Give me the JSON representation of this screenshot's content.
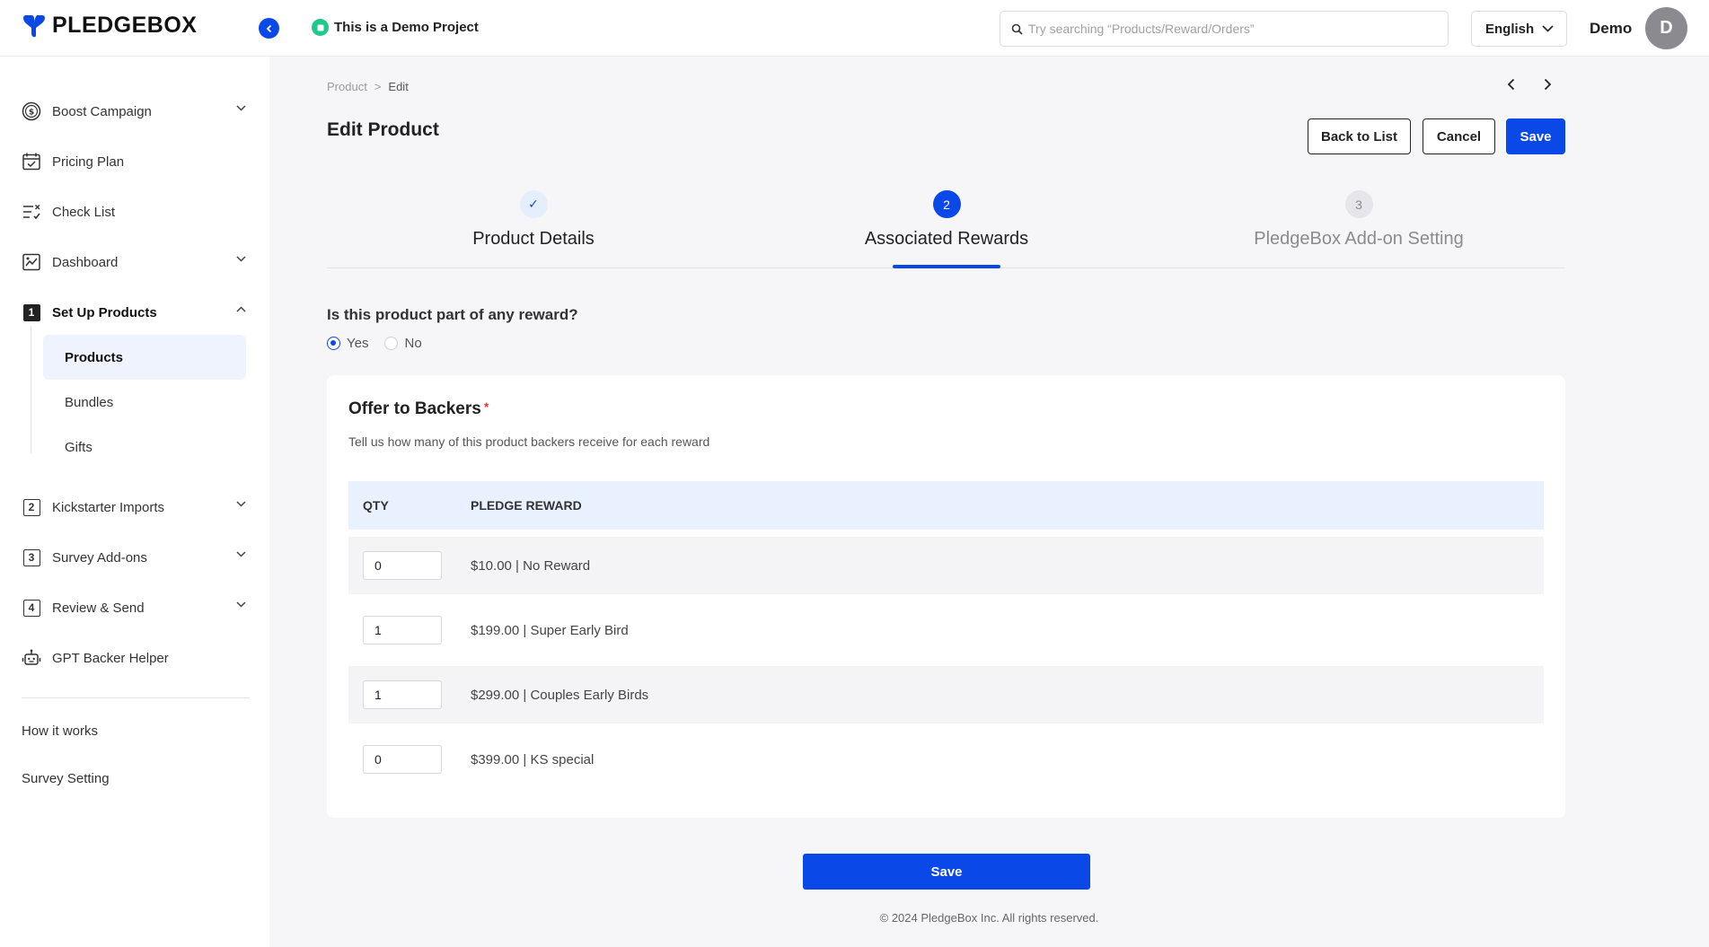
{
  "header": {
    "logo_text": "PLEDGEBOX",
    "project_label": "This is a Demo Project",
    "search_placeholder": "Try searching “Products/Reward/Orders”",
    "language": "English",
    "user_name": "Demo",
    "avatar_initial": "D"
  },
  "sidebar": {
    "items": [
      {
        "label": "Boost Campaign",
        "icon": "dollar-coin-icon"
      },
      {
        "label": "Pricing Plan",
        "icon": "calendar-check-icon"
      },
      {
        "label": "Check List",
        "icon": "checklist-icon"
      },
      {
        "label": "Dashboard",
        "icon": "chart-icon"
      },
      {
        "label": "Set Up Products",
        "icon": "number-1-icon",
        "num": "1"
      },
      {
        "label": "Kickstarter Imports",
        "icon": "number-2-icon",
        "num": "2"
      },
      {
        "label": "Survey Add-ons",
        "icon": "number-3-icon",
        "num": "3"
      },
      {
        "label": "Review & Send",
        "icon": "number-4-icon",
        "num": "4"
      },
      {
        "label": "GPT Backer Helper",
        "icon": "robot-icon"
      }
    ],
    "sub_items": [
      "Products",
      "Bundles",
      "Gifts"
    ],
    "links": [
      "How it works",
      "Survey Setting"
    ]
  },
  "breadcrumb": {
    "parent": "Product",
    "separator": ">",
    "current": "Edit"
  },
  "page": {
    "title": "Edit Product",
    "back_label": "Back to List",
    "cancel_label": "Cancel",
    "save_label": "Save"
  },
  "steps": [
    {
      "label": "Product Details",
      "marker": "✓",
      "state": "done"
    },
    {
      "label": "Associated Rewards",
      "marker": "2",
      "state": "current"
    },
    {
      "label": "PledgeBox Add-on Setting",
      "marker": "3",
      "state": "todo"
    }
  ],
  "reward_question": {
    "text": "Is this product part of any reward?",
    "yes": "Yes",
    "no": "No",
    "selected": "Yes"
  },
  "offer": {
    "title": "Offer to Backers",
    "required_mark": "*",
    "subtitle": "Tell us how many of this product backers receive for each reward",
    "columns": [
      "QTY",
      "PLEDGE REWARD"
    ],
    "rows": [
      {
        "qty": "0",
        "reward": "$10.00 | No Reward"
      },
      {
        "qty": "1",
        "reward": "$199.00 | Super Early Bird"
      },
      {
        "qty": "1",
        "reward": "$299.00 | Couples Early Birds"
      },
      {
        "qty": "0",
        "reward": "$399.00 | KS special"
      }
    ]
  },
  "bottom_save_label": "Save",
  "footer_text": "© 2024 PledgeBox Inc. All rights reserved.",
  "colors": {
    "accent": "#0a49e8",
    "demo_badge": "#1fc98a"
  }
}
